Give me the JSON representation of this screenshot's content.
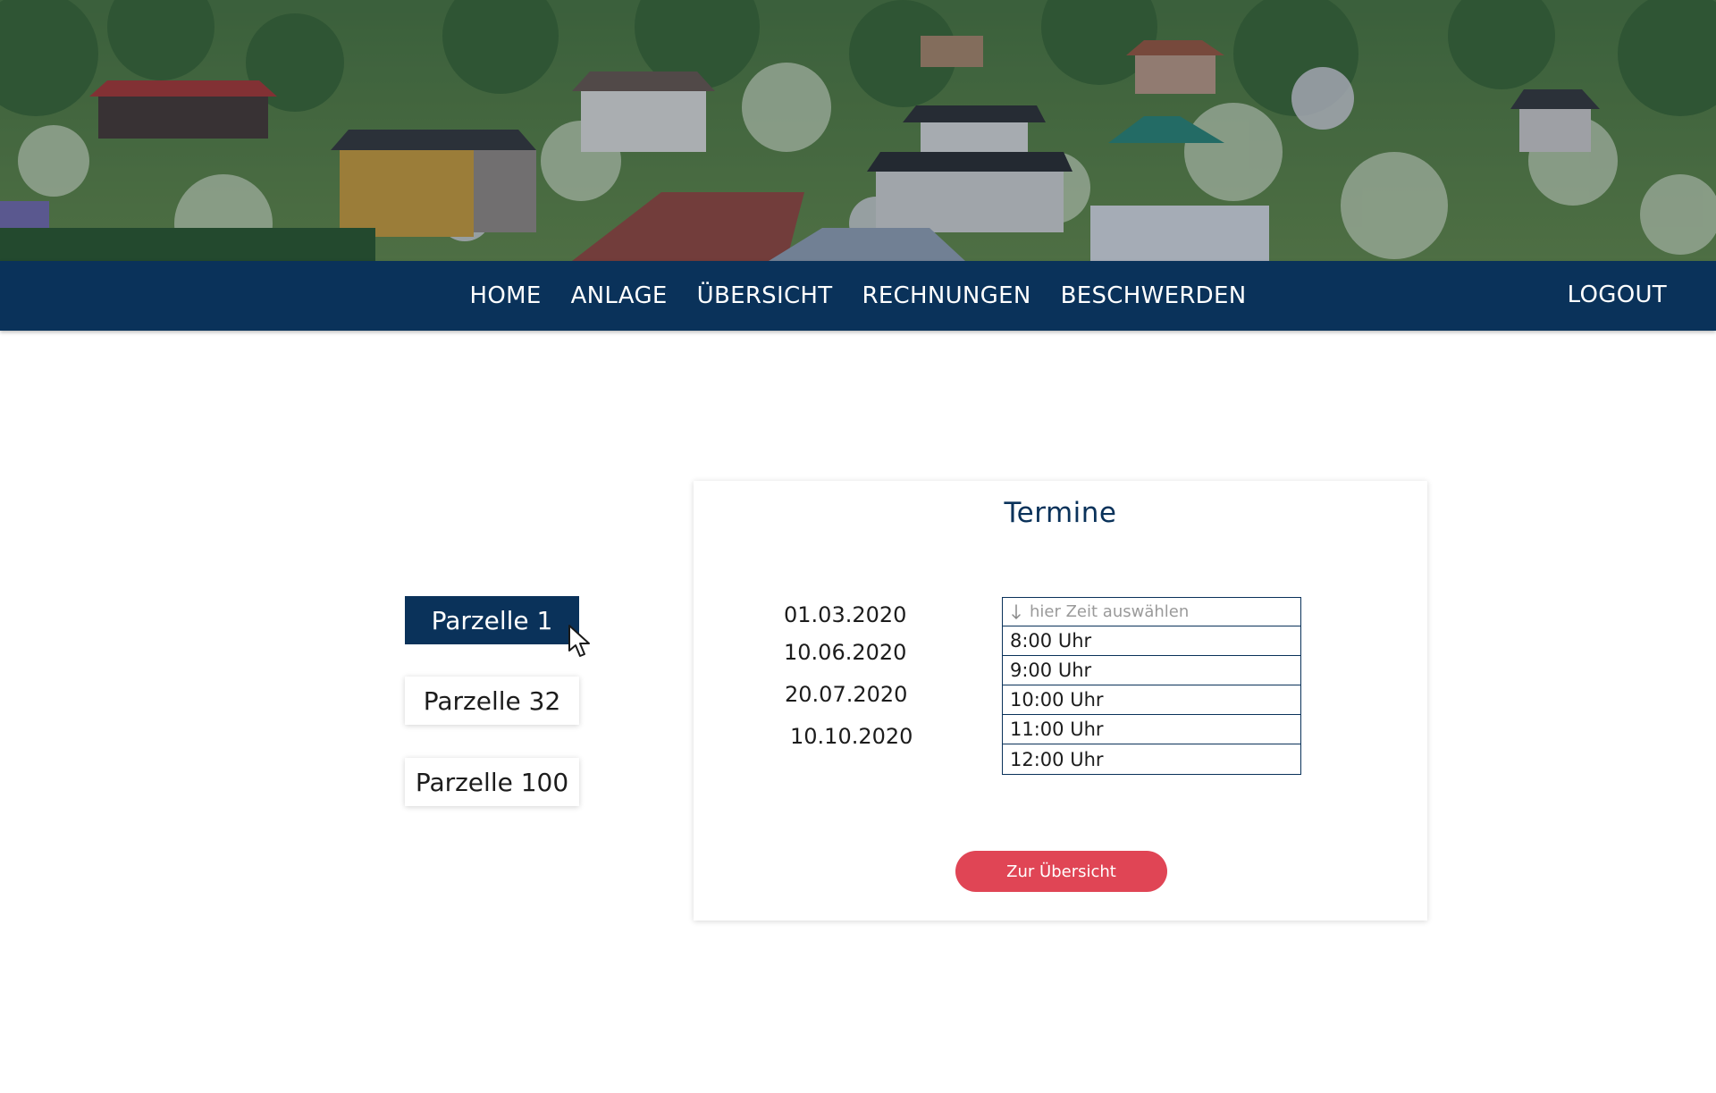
{
  "nav": {
    "items": [
      {
        "label": "HOME"
      },
      {
        "label": "ANLAGE"
      },
      {
        "label": "ÜBERSICHT"
      },
      {
        "label": "RECHNUNGEN"
      },
      {
        "label": "BESCHWERDEN"
      }
    ],
    "logout_label": "LOGOUT"
  },
  "parcels": [
    {
      "label": "Parzelle 1",
      "active": true
    },
    {
      "label": "Parzelle 32",
      "active": false
    },
    {
      "label": "Parzelle 100",
      "active": false
    }
  ],
  "card": {
    "title": "Termine",
    "dates": [
      "01.03.2020",
      "10.06.2020",
      "20.07.2020",
      "10.10.2020"
    ],
    "time_picker": {
      "placeholder": "hier Zeit auswählen",
      "options": [
        "8:00 Uhr",
        "9:00 Uhr",
        "10:00 Uhr",
        "11:00 Uhr",
        "12:00 Uhr"
      ]
    },
    "overview_button": "Zur Übersicht"
  },
  "colors": {
    "primary": "#0a325a",
    "accent": "#e04555",
    "background": "#ffffff"
  },
  "icons": {
    "cursor": "mouse-pointer-icon",
    "dropdown": "arrow-down-icon"
  }
}
